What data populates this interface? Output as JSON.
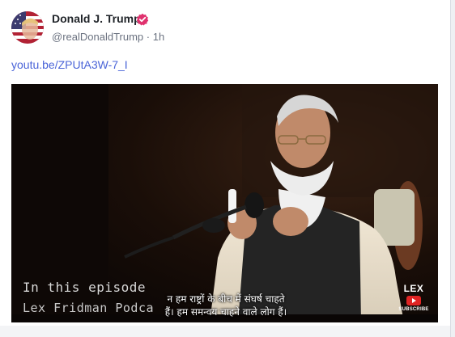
{
  "post": {
    "author_name": "Donald J. Trump",
    "handle": "@realDonaldTrump",
    "separator": "·",
    "time": "1h",
    "link_text": "youtu.be/ZPUtA3W-7_I",
    "verified_icon": "verified-badge-icon",
    "accent_color": "#e0316e",
    "link_color": "#4a64d8"
  },
  "video": {
    "overlay_line1": "In this episode",
    "overlay_line2": "Lex Fridman Podca",
    "subtitle_line1": "न हम राष्ट्रों के बीच में संघर्ष चाहते",
    "subtitle_line2": "हैं। हम समन्वय चाहने वाले लोग हैं।",
    "channel_logo": "LEX",
    "subscribe_label": "SUBSCRIBE",
    "play_icon": "youtube-play-icon"
  }
}
